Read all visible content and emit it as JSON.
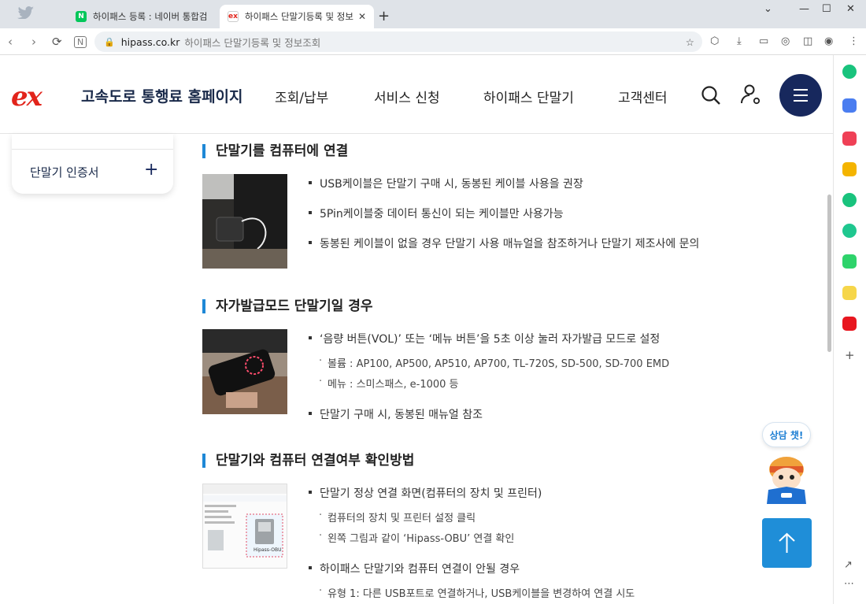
{
  "browser": {
    "tabs": [
      {
        "title": "하이패스 등록 : 네이버 통합검색",
        "active": false,
        "favicon": "N"
      },
      {
        "title": "하이패스 단말기등록 및 정보조회",
        "active": true,
        "favicon": "ex"
      }
    ],
    "address": {
      "host": "hipass.co.kr",
      "page_title": "하이패스 단말기등록 및 정보조회"
    }
  },
  "site": {
    "logo_mark": "ex",
    "logo_text": "고속도로 통행료 홈페이지",
    "nav": [
      "조회/납부",
      "서비스 신청",
      "하이패스 단말기",
      "고객센터"
    ]
  },
  "left_menu": {
    "item": "단말기 인증서"
  },
  "sections": [
    {
      "title": "단말기를 컴퓨터에 연결",
      "bullets": [
        {
          "text": "USB케이블은 단말기 구매 시, 동봉된 케이블 사용을 권장",
          "subs": []
        },
        {
          "text": "5Pin케이블중 데이터 통신이 되는 케이블만 사용가능",
          "subs": []
        },
        {
          "text": "동봉된 케이블이 없을 경우 단말기 사용 매뉴얼을 참조하거나 단말기 제조사에 문의",
          "subs": []
        }
      ]
    },
    {
      "title": "자가발급모드 단말기일 경우",
      "bullets": [
        {
          "text": "‘음량 버튼(VOL)’ 또는 ‘메뉴 버튼’을 5초 이상 눌러 자가발급 모드로 설정",
          "subs": [
            "볼륨 : AP100, AP500, AP510, AP700, TL-720S, SD-500, SD-700 EMD",
            "메뉴 : 스미스패스, e-1000 등"
          ]
        },
        {
          "text": "단말기 구매 시, 동봉된 매뉴얼 참조",
          "subs": []
        }
      ]
    },
    {
      "title": "단말기와 컴퓨터 연결여부 확인방법",
      "bullets": [
        {
          "text": "단말기 정상 연결 화면(컴퓨터의 장치 및 프린터)",
          "subs": [
            "컴퓨터의 장치 및 프린터 설정 클릭",
            "왼쪽 그림과 같이 ‘Hipass-OBU’ 연결 확인"
          ]
        },
        {
          "text": "하이패스 단말기와 컴퓨터 연결이 안될 경우",
          "subs": [
            "유형 1: 다른 USB포트로 연결하거나, USB케이블을 변경하여 연결 시도"
          ]
        }
      ]
    }
  ],
  "thumb3_label": "Hipass-OBU",
  "chat": {
    "label": "상담 챗!"
  },
  "colors": {
    "brand_red": "#e2241b",
    "navy": "#17285d",
    "accent_blue": "#1e88d6"
  }
}
